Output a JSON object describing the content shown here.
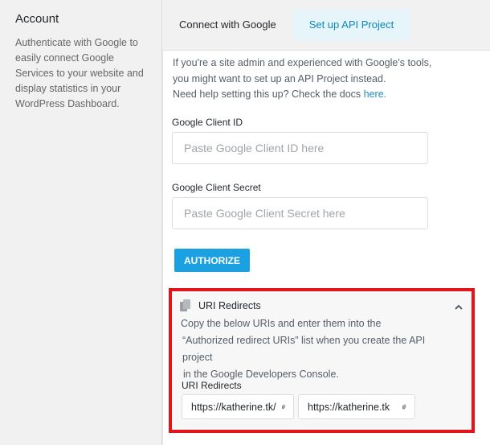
{
  "account": {
    "title": "Account",
    "description": "Authenticate with Google to easily connect Google Services to your website and display statistics in your WordPress Dashboard."
  },
  "tabs": [
    {
      "label": "Connect with Google",
      "active": false
    },
    {
      "label": "Set up API Project",
      "active": true
    }
  ],
  "intro": {
    "text": "If you're a site admin and experienced with Google's tools, you might want to set up an API Project instead.",
    "help_text": "Need help setting this up? Check the docs ",
    "help_link": "here."
  },
  "client_id": {
    "label": "Google Client ID",
    "placeholder": "Paste Google Client ID here",
    "value": ""
  },
  "client_secret": {
    "label": "Google Client Secret",
    "placeholder": "Paste Google Client Secret here",
    "value": ""
  },
  "authorize_label": "AUTHORIZE",
  "uri_redirects": {
    "title": "URI Redirects",
    "desc_line1": "Copy the below URIs and enter them into the",
    "desc_line2": "“Authorized redirect URIs” list when you create the API project",
    "desc_line3": "in the Google Developers Console.",
    "sub_label": "URI Redirects",
    "uris": [
      "https://katherine.tk/",
      "https://katherine.tk"
    ],
    "icons": {
      "header": "document-copy-icon",
      "toggle": "chevron-up-icon",
      "copy": "copy-icon"
    }
  },
  "colors": {
    "active_tab_bg": "#e5f5fa",
    "active_tab_text": "#0e87b7",
    "button": "#1ba1e2",
    "highlight_border": "#e5141c",
    "link": "#1e8cbe"
  }
}
